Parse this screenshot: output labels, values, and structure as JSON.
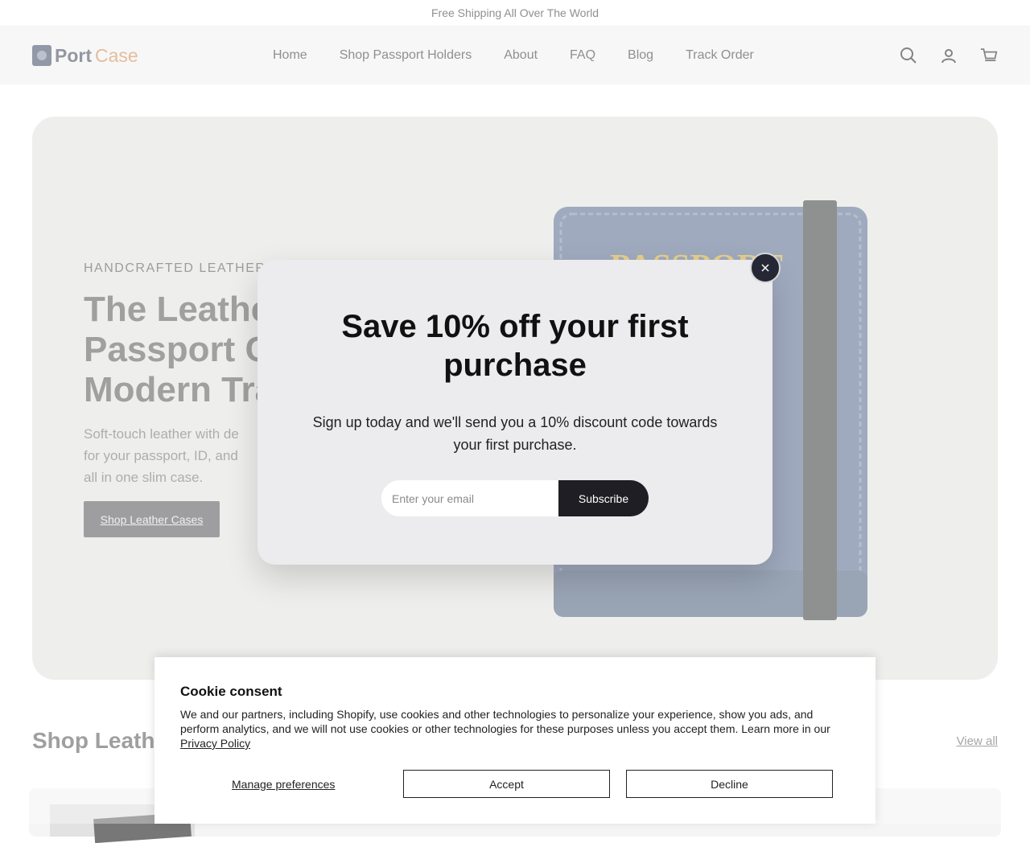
{
  "announcement": "Free Shipping All Over The World",
  "brand": {
    "first": "Port",
    "second": "Case"
  },
  "nav": [
    "Home",
    "Shop Passport Holders",
    "About",
    "FAQ",
    "Blog",
    "Track Order"
  ],
  "icons": {
    "search": "search-icon",
    "account": "user-icon",
    "cart": "cart-icon",
    "close": "close-icon"
  },
  "hero": {
    "eyebrow": "HANDCRAFTED LEATHER",
    "title_line_1": "The Leather",
    "title_line_2": "Passport Ca",
    "title_line_3": "Modern Tra",
    "description_line_1": "Soft-touch leather with de",
    "description_line_2": "for your passport, ID, and",
    "description_line_3": "all in one slim case.",
    "button": "Shop Leather Cases",
    "passport_label": "PASSPORT"
  },
  "popup": {
    "title_line_1": "Save 10% off your first",
    "title_line_2": "purchase",
    "text": "Sign up today and we'll send you a 10% discount code towards your first purchase.",
    "email_placeholder": "Enter your email",
    "subscribe_label": "Subscribe"
  },
  "section": {
    "title": "Shop Leathe",
    "view_all": "View all"
  },
  "cookie": {
    "title": "Cookie consent",
    "text": "We and our partners, including Shopify, use cookies and other technologies to personalize your experience, show you ads, and perform analytics, and we will not use cookies or other technologies for these purposes unless you accept them. Learn more in our ",
    "privacy_link": "Privacy Policy",
    "manage": "Manage preferences",
    "accept": "Accept",
    "decline": "Decline"
  },
  "colors": {
    "hero_bg": "#e6e7e2",
    "dark_button": "#1e1e24",
    "passport_blue": "#6f7f9e",
    "passport_gold": "#d8b74e"
  }
}
